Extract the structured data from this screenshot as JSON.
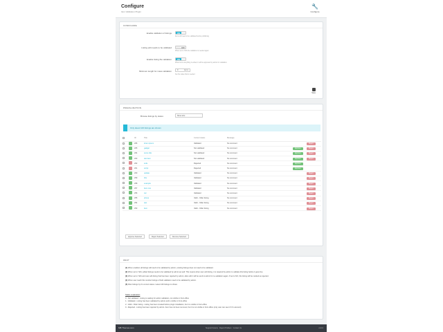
{
  "header": {
    "title": "Configure",
    "subtitle": "Item Validation Plugin",
    "configure_label": "Configure"
  },
  "config": {
    "section_title": "CONFIGURE",
    "rows": [
      {
        "label": "Enable validation of listings",
        "toggle": "ON",
        "hint": "Items will need to be validated before publishing"
      },
      {
        "label": "Listing edit needs to be validated",
        "toggle": "OFF",
        "hint": "When set to YES the validation is needed again"
      },
      {
        "label": "Enable listing file validation",
        "toggle": "ON",
        "hint": "When item everything is edited, it will be approved by admin for validation"
      },
      {
        "label": "Minimum length for mass validation",
        "value": "0",
        "unit": "items",
        "hint": "Set the value that is needed"
      }
    ],
    "save_label": "Save"
  },
  "preview": {
    "section_title": "PREVALIDATION",
    "filter_label": "Browse listings by status",
    "filter_value": "Show all",
    "info": "Only latest 100 listings are shown",
    "columns": [
      "",
      "",
      "ID",
      "Title",
      "Current status",
      "Message",
      "",
      ""
    ],
    "rows": [
      {
        "status": "g",
        "id": "266",
        "title": "lorem ipsum",
        "current": "Validated",
        "msg": "No comment",
        "approve": "",
        "reject": "Reject"
      },
      {
        "status": "g",
        "id": "265",
        "title": "gadget",
        "current": "Not validated",
        "msg": "No comment",
        "approve": "Approve",
        "reject": "Reject"
      },
      {
        "status": "g",
        "id": "264",
        "title": "some title",
        "current": "Not validated",
        "msg": "No comment",
        "approve": "Approve",
        "reject": "Reject"
      },
      {
        "status": "g",
        "id": "263",
        "title": "test item",
        "current": "Not validated",
        "msg": "No comment",
        "approve": "Approve",
        "reject": "Reject"
      },
      {
        "status": "r",
        "id": "262",
        "title": "sofa",
        "current": "Rejected",
        "msg": "No comment",
        "approve": "Approve",
        "reject": ""
      },
      {
        "status": "r",
        "id": "261",
        "title": "script",
        "current": "Rejected",
        "msg": "No comment",
        "approve": "Approve",
        "reject": ""
      },
      {
        "status": "g",
        "id": "260",
        "title": "update",
        "current": "Validated",
        "msg": "No comment",
        "approve": "",
        "reject": "Reject"
      },
      {
        "status": "g",
        "id": "259",
        "title": "this",
        "current": "Validated",
        "msg": "No comment",
        "approve": "",
        "reject": "Reject"
      },
      {
        "status": "g",
        "id": "258",
        "title": "example",
        "current": "Validated",
        "msg": "No comment",
        "approve": "",
        "reject": "Reject"
      },
      {
        "status": "g",
        "id": "257",
        "title": "item one",
        "current": "Validated",
        "msg": "No comment",
        "approve": "",
        "reject": "Reject"
      },
      {
        "status": "g",
        "id": "256",
        "title": "car",
        "current": "Validated",
        "msg": "No comment",
        "approve": "",
        "reject": "Reject"
      },
      {
        "status": "g",
        "id": "255",
        "title": "phone",
        "current": "Valid - Older listing",
        "msg": "No comment",
        "approve": "",
        "reject": "Reject"
      },
      {
        "status": "g",
        "id": "254",
        "title": "test",
        "current": "Valid - Older listing",
        "msg": "No comment",
        "approve": "",
        "reject": "Reject"
      },
      {
        "status": "g",
        "id": "253",
        "title": "item",
        "current": "Valid - Older listing",
        "msg": "No comment",
        "approve": "",
        "reject": "Reject"
      }
    ],
    "bulk_buttons": [
      "Approve Selected",
      "Reject Selected",
      "Remove Selected"
    ]
  },
  "help": {
    "section_title": "HELP",
    "items": [
      {
        "k": "(1)",
        "t": "When enabled, all listings will need to be validated by admin, existing listings does not need to be validated."
      },
      {
        "k": "(2)",
        "t": "When set to YES, edited listings needs to be validated by admin as well. This means when user edit listing, it is required by admin to validate this listing before it goes live."
      },
      {
        "k": "(3)",
        "t": "When set to YES and user edit listing that has been rejected by admin, after edit it will be send to admin for re-validation again. If set to NO, this listing will be marked as rejected."
      },
      {
        "k": "(4)",
        "t": "When user reach this number listings of bulk validation need to be validated by admin."
      },
      {
        "k": "(5)",
        "t": "Filter listings by it's current status. Latest 100 listings is shown."
      }
    ],
    "legend_title": "Status explanation",
    "legend": [
      "0 - Not validated - Listing is waiting for admin validation, not visible in front-office",
      "1 - Validated - Listing has been validated by admin and is visible in front-office",
      "2 - Valid - Older listing - Listing has been created before plugin installation, but it is visible in front-office",
      "9 - Rejected - Listing has been rejected by admin. Item has not been removed, but it is not visible in front-office (only user can see it if it's account)"
    ]
  },
  "footer": {
    "brand": "MB Themes.com",
    "links": [
      "Support Forums",
      "Report Problem",
      "Contact Us"
    ],
    "version": "v1.0.0"
  }
}
